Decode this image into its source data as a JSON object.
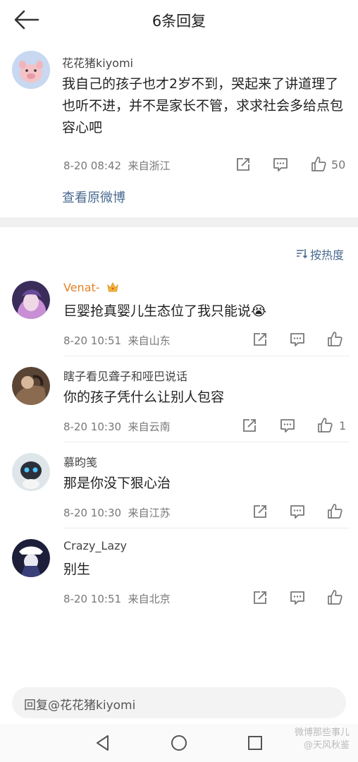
{
  "header": {
    "title": "6条回复"
  },
  "root_comment": {
    "username": "花花猪kiyomi",
    "body": "我自己的孩子也才2岁不到，哭起来了讲道理了也听不进，并不是家长不管，求求社会多给点包容心吧",
    "time": "8-20 08:42",
    "location": "来自浙江",
    "likes": "50",
    "view_original": "查看原微博"
  },
  "sort": {
    "label": "按热度"
  },
  "replies": [
    {
      "username": "Venat-",
      "body": "巨婴抢真婴儿生态位了我只能说😭",
      "time": "8-20 10:51",
      "location": "来自山东",
      "likes": ""
    },
    {
      "username": "瞎子看见聋子和哑巴说话",
      "body": "你的孩子凭什么让别人包容",
      "time": "8-20 10:30",
      "location": "来自云南",
      "likes": "1"
    },
    {
      "username": "慕昀笺",
      "body": "那是你没下狠心治",
      "time": "8-20 10:30",
      "location": "来自江苏",
      "likes": ""
    },
    {
      "username": "Crazy_Lazy",
      "body": "别生",
      "time": "8-20 10:51",
      "location": "来自北京",
      "likes": ""
    }
  ],
  "reply_input": {
    "placeholder": "回复@花花猪kiyomi"
  },
  "watermark": {
    "line1": "微博那些事儿",
    "line2": "@天风秋鉴"
  },
  "colors": {
    "link": "#4a6a8f",
    "meta": "#777777",
    "band": "#f0f0f0",
    "crown": "#f2b830"
  }
}
